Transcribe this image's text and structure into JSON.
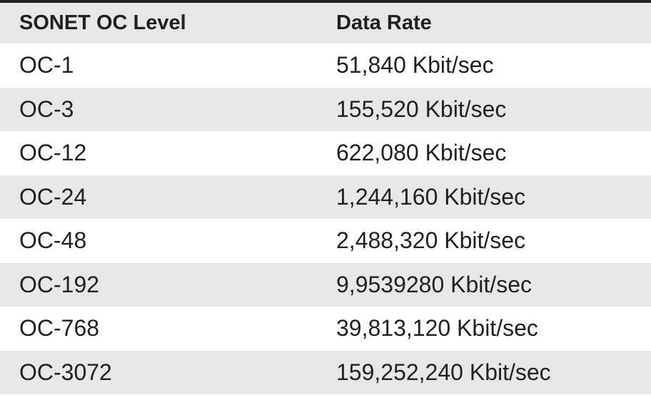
{
  "table": {
    "headers": [
      "SONET OC Level",
      "Data Rate"
    ],
    "rows": [
      [
        "OC-1",
        "51,840 Kbit/sec"
      ],
      [
        "OC-3",
        "155,520 Kbit/sec"
      ],
      [
        "OC-12",
        "622,080 Kbit/sec"
      ],
      [
        "OC-24",
        "1,244,160 Kbit/sec"
      ],
      [
        "OC-48",
        "2,488,320 Kbit/sec"
      ],
      [
        "OC-192",
        "9,9539280 Kbit/sec"
      ],
      [
        "OC-768",
        "39,813,120 Kbit/sec"
      ],
      [
        "OC-3072",
        "159,252,240 Kbit/sec"
      ]
    ]
  },
  "colors": {
    "rule": "#231f20",
    "stripe": "#e6e7e8",
    "text": "#231f20"
  }
}
